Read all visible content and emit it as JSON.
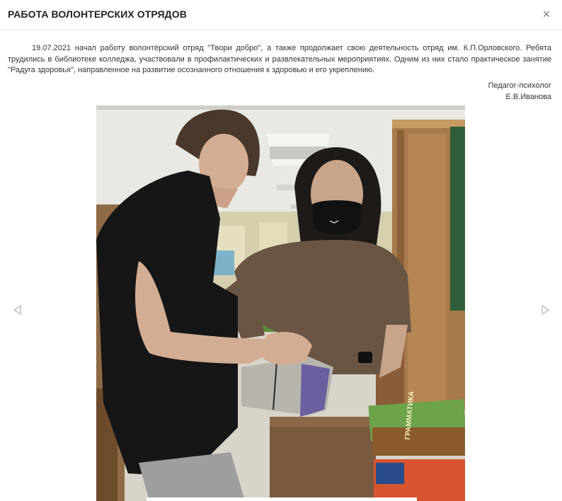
{
  "modal": {
    "title": "РАБОТА ВОЛОНТЕРСКИХ ОТРЯДОВ",
    "close_label": "×"
  },
  "article": {
    "paragraph": "19.07.2021 начал работу волонтёрский отряд \"Твори добро\", а также продолжает свою деятельность отряд им. К.П.Орловского. Ребята трудились в библиотеке колледжа, участвовали в профилактических и развлекательных мероприятиях. Одним из них стало практическое занятие \"Радуга здоровья\", направленное на развитие осознанного отношения к здоровью и его укреплению.",
    "author_role": "Педагог-психолог",
    "author_name": "Е.В.Иванова"
  },
  "gallery": {
    "prev_icon": "chevron-left-icon",
    "next_icon": "chevron-right-icon",
    "book_titles": [
      "ГРАММАТИКА"
    ]
  }
}
